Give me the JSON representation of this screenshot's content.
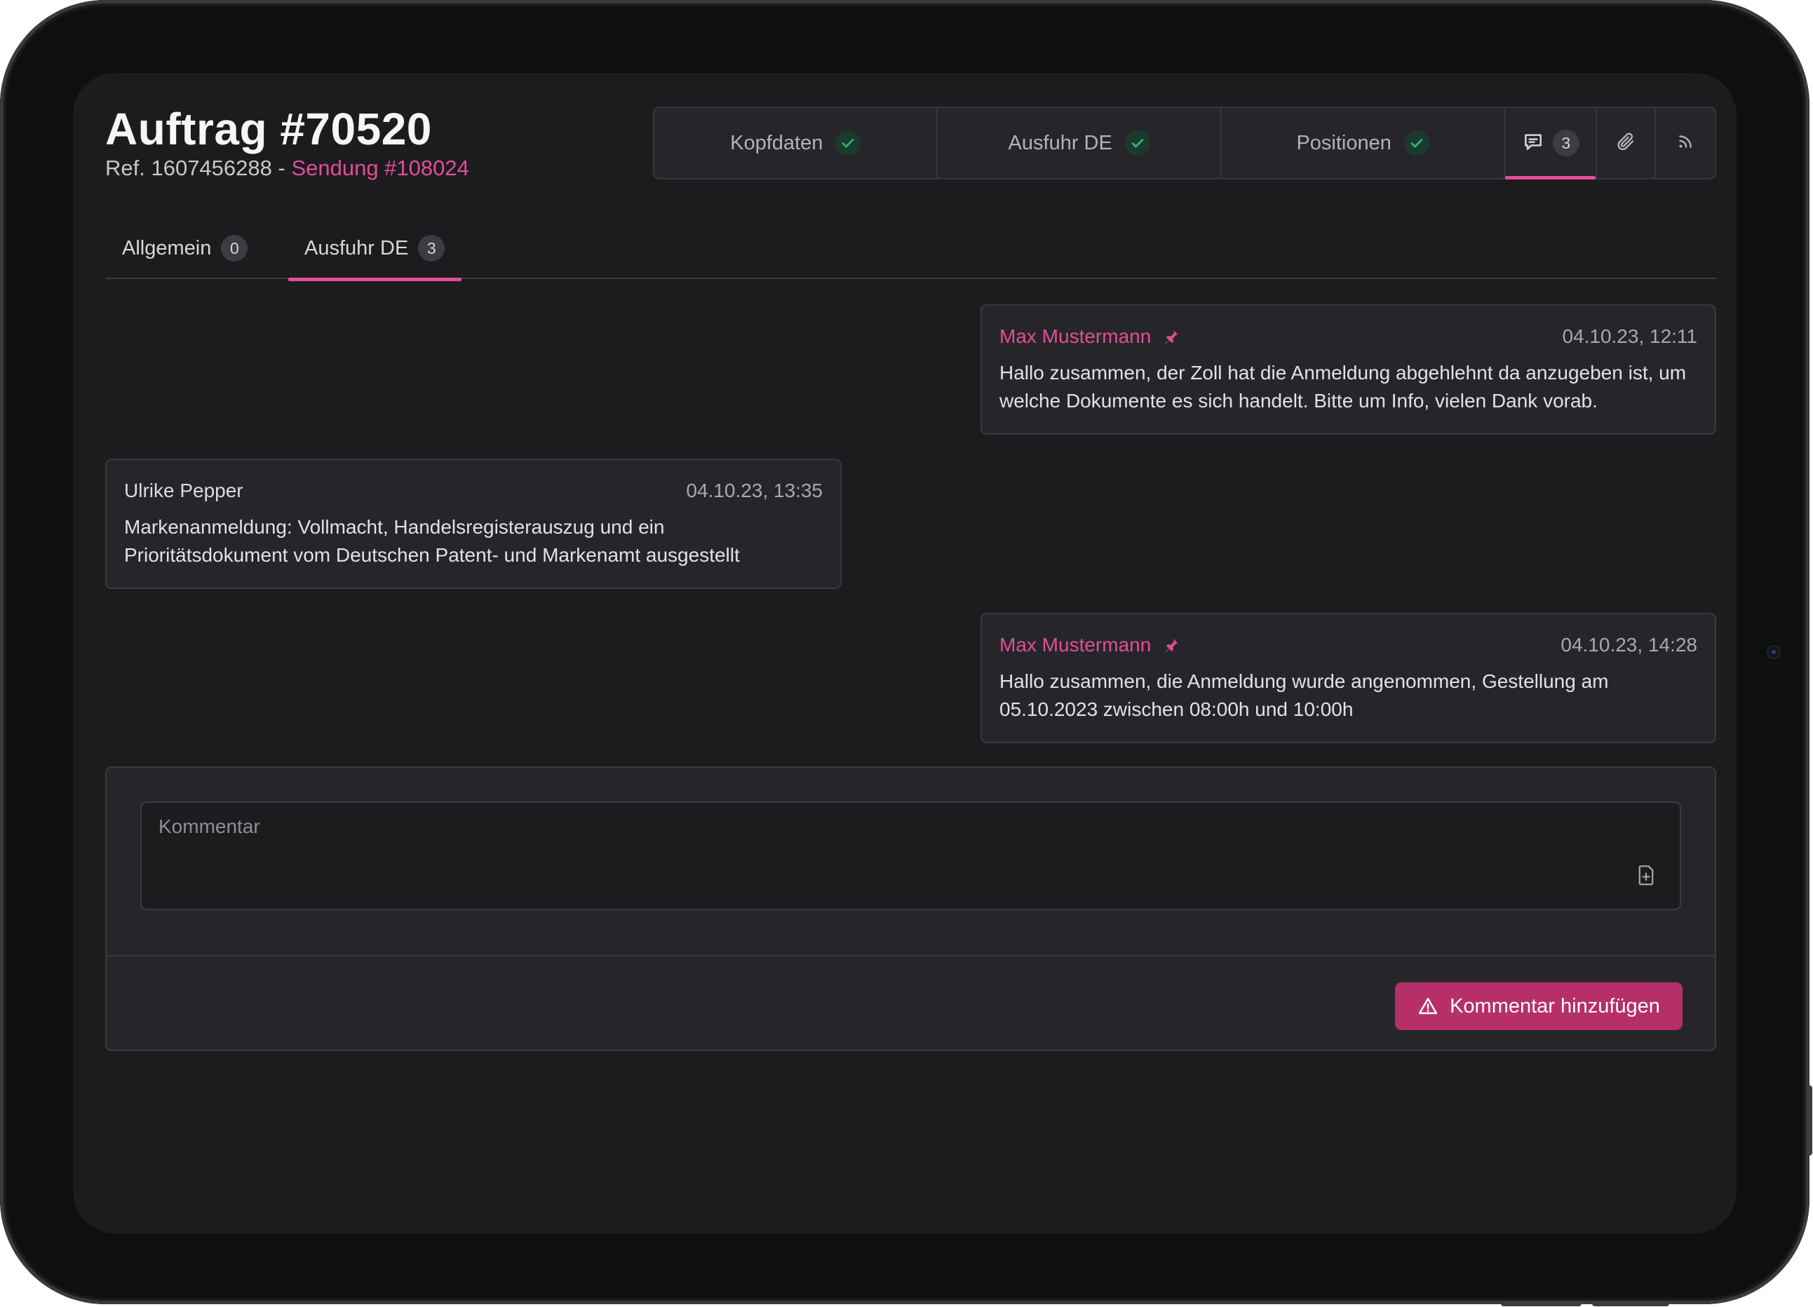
{
  "order": {
    "title": "Auftrag #70520",
    "ref_prefix": "Ref. 1607456288 - ",
    "shipment_link": "Sendung #108024"
  },
  "steps": [
    {
      "label": "Kopfdaten",
      "status": "complete",
      "icon": "check-icon"
    },
    {
      "label": "Ausfuhr DE",
      "status": "complete",
      "icon": "check-icon"
    },
    {
      "label": "Positionen",
      "status": "complete",
      "icon": "check-icon"
    }
  ],
  "icon_tabs": {
    "comments": {
      "icon": "chat-icon",
      "count": "3",
      "active": true
    },
    "attachments": {
      "icon": "paperclip-icon"
    },
    "feed": {
      "icon": "rss-icon"
    }
  },
  "sub_tabs": [
    {
      "label": "Allgemein",
      "count": "0",
      "active": false
    },
    {
      "label": "Ausfuhr DE",
      "count": "3",
      "active": true
    }
  ],
  "messages": [
    {
      "author": "Max Mustermann",
      "own": true,
      "time": "04.10.23, 12:11",
      "text": "Hallo zusammen, der Zoll hat die Anmeldung abgehlehnt da anzugeben ist, um welche Dokumente es sich handelt. Bitte um Info, vielen Dank vorab."
    },
    {
      "author": "Ulrike Pepper",
      "own": false,
      "time": "04.10.23, 13:35",
      "text": "Markenanmeldung: Vollmacht, Handelsregisterauszug und ein Prioritätsdokument vom Deutschen Patent- und Markenamt ausgestellt"
    },
    {
      "author": "Max Mustermann",
      "own": true,
      "time": "04.10.23, 14:28",
      "text": "Hallo zusammen, die Anmeldung wurde angenommen, Gestellung am 05.10.2023 zwischen 08:00h und 10:00h"
    }
  ],
  "comment_form": {
    "placeholder": "Kommentar",
    "value": "",
    "submit_label": "Kommentar hinzufügen",
    "submit_icon": "warning-triangle-icon",
    "attach_icon": "file-plus-icon"
  },
  "colors": {
    "accent": "#e24d97",
    "button": "#b72f68",
    "success": "#2bb673",
    "background": "#1c1c1f",
    "surface": "#26262a"
  }
}
